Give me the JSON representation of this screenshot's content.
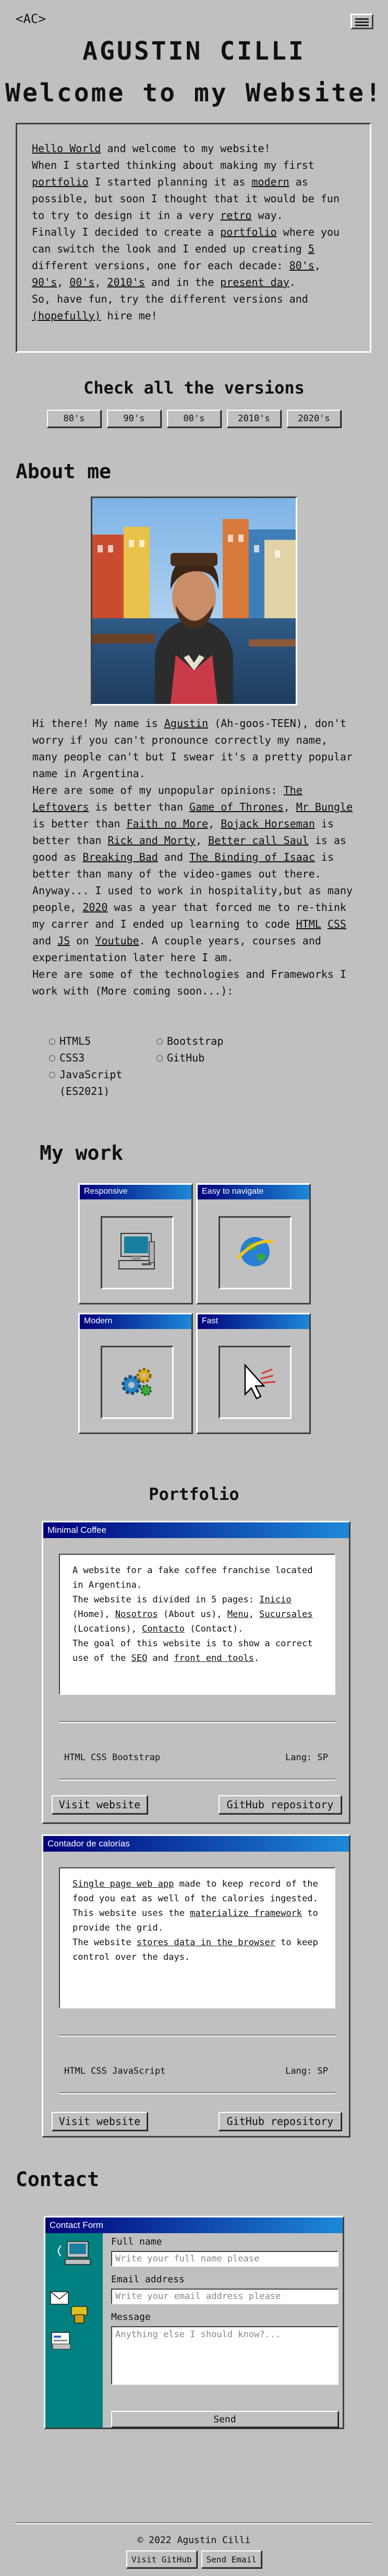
{
  "header": {
    "logo": "<AC>"
  },
  "hero": {
    "name": "AGUSTIN CILLI",
    "welcome": "Welcome to my Website!"
  },
  "intro": {
    "hello": "Hello World",
    "l1_rest": " and welcome to my website!",
    "l2": "When I started thinking about making my first ",
    "portfolio": "portfolio",
    "l3": " I started planning it as ",
    "modern": "modern",
    "l4": " as possible, but soon I thought that it would be fun to try to design it in a very ",
    "retro": "retro",
    "l5": " way.",
    "l6": "Finally I decided to create a ",
    "portfolio2": "portfolio",
    "l7": " where you can switch the look and I ended up creating ",
    "five": "5",
    "l8": " different versions, one for each decade: ",
    "d80": "80's",
    "d90": "90's",
    "d00": "00's",
    "d2010": "2010's",
    "l9": " and in the ",
    "present": "present day",
    "l10": "So, have fun, try the different versions and ",
    "hopefully": "(hopefully)",
    "l11": " hire me!"
  },
  "versions": {
    "title": "Check all the versions",
    "buttons": [
      "80's",
      "90's",
      "00's",
      "2010's",
      "2020's"
    ]
  },
  "about": {
    "title": "About me",
    "p1a": "Hi there! My name is ",
    "agustin": "Agustin",
    "p1b": " (Ah-goos-TEEN), don't worry if you can't pronounce correctly my name, many people can't but I swear it's a pretty popular name in Argentina.",
    "p2a": "Here are some of my unpopular opinions: ",
    "leftovers": "The Leftovers",
    "p2b": " is better than ",
    "got": "Game of Thrones",
    "p2c": ", ",
    "bungle": "Mr Bungle",
    "p2d": " is better than ",
    "fnm": "Faith no More",
    "p2e": ", ",
    "bojack": "Bojack Horseman",
    "p2f": " is better than ",
    "rm": "Rick and Morty",
    "p2g": ", ",
    "bcs": "Better call Saul",
    "p2h": " is as good as ",
    "bb": "Breaking Bad",
    "p2i": " and ",
    "boi": "The Binding of Isaac",
    "p2j": " is better than many of the video-games out there.",
    "p3a": "Anyway... I used to work in hospitality,but as many people, ",
    "y2020": "2020",
    "p3b": " was a year that forced me to re-think my carrer and I ended up learning to code ",
    "html": "HTML",
    "p3c": " ",
    "css": "CSS",
    "p3d": " and ",
    "js": "JS",
    "p3e": " on ",
    "yt": "Youtube",
    "p3f": ". A couple years, courses and experimentation later here I am.",
    "p4": "Here are some of the technologies and Frameworks I work with (More coming soon...):",
    "tech_left": [
      "HTML5",
      "CSS3",
      "JavaScript (ES2021)"
    ],
    "tech_right": [
      "Bootstrap",
      "GitHub"
    ]
  },
  "work": {
    "title": "My work",
    "cards": [
      "Responsive",
      "Easy to navigate",
      "Modern",
      "Fast"
    ]
  },
  "portfolio": {
    "title": "Portfolio",
    "p1": {
      "title": "Minimal Coffee",
      "d1": "A website for a fake coffee franchise located in Argentina.",
      "d2a": "The website is divided in 5 pages: ",
      "inicio": "Inicio",
      "d2b": " (Home), ",
      "nosotros": "Nosotros",
      "d2c": " (About us), ",
      "menu": "Menu",
      "d2d": ", ",
      "sucursales": "Sucursales",
      "d2e": " (Locations), ",
      "contacto": "Contacto",
      "d2f": " (Contact).",
      "d3a": "The goal of this website is to show a correct use of the ",
      "seo": "SEO",
      "d3b": " and ",
      "frontend": "front end tools",
      "d3c": ".",
      "tech": "HTML  CSS  Bootstrap",
      "lang": "Lang: SP",
      "visit": "Visit website",
      "repo": "GitHub repository"
    },
    "p2": {
      "title": "Contador de calorías",
      "spa": "Single page web app",
      "d1b": " made to keep record of the food you eat as well of the calories ingested. This website uses the ",
      "mat": "materialize framework",
      "d1c": " to provide the grid.",
      "d2a": "The website ",
      "stores": "stores data in the browser",
      "d2b": " to keep control over the days.",
      "tech": "HTML  CSS  JavaScript",
      "lang": "Lang: SP",
      "visit": "Visit website",
      "repo": "GitHub repository"
    }
  },
  "contact": {
    "title": "Contact",
    "form_title": "Contact Form",
    "name_label": "Full name",
    "name_ph": "Write your full name please",
    "email_label": "Email address",
    "email_ph": "Write your email address please",
    "msg_label": "Message",
    "msg_ph": "Anything else I should know?...",
    "send": "Send"
  },
  "footer": {
    "copy": "© 2022 Agustin Cilli",
    "btn1": "Visit GitHub",
    "btn2": "Send Email"
  }
}
